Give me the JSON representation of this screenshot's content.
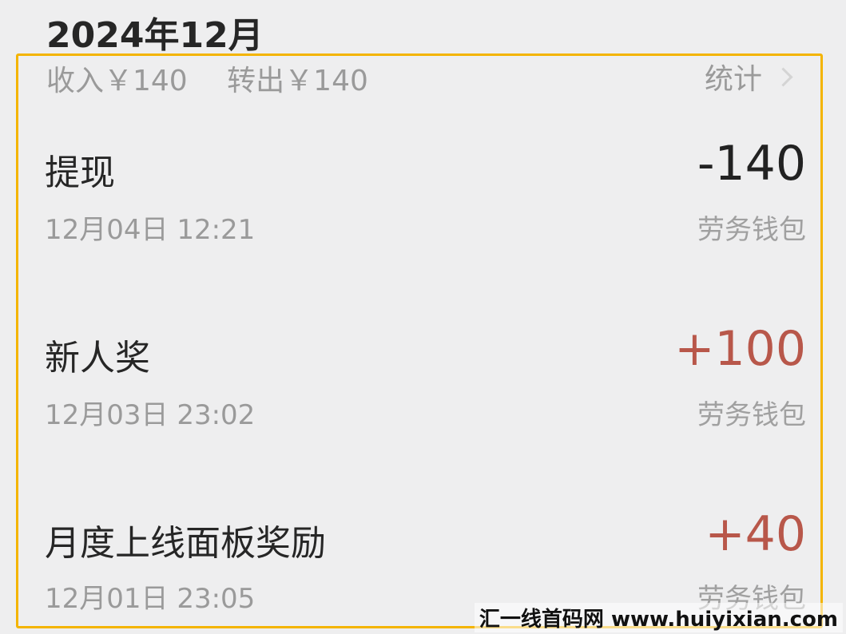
{
  "header": {
    "month": "2024年12月"
  },
  "summary": {
    "income": "收入￥140",
    "transfer_out": "转出￥140",
    "stats_label": "统计"
  },
  "colors": {
    "negative_amount": "#222222",
    "positive_amount": "#b8574a",
    "highlight_border": "#f4b400"
  },
  "transactions": [
    {
      "title": "提现",
      "amount": "-140",
      "time": "12月04日 12:21",
      "wallet": "劳务钱包"
    },
    {
      "title": "新人奖",
      "amount": "+100",
      "time": "12月03日 23:02",
      "wallet": "劳务钱包"
    },
    {
      "title": "月度上线面板奖励",
      "amount": "+40",
      "time": "12月01日 23:05",
      "wallet": "劳务钱包"
    }
  ],
  "watermark": "汇一线首码网 www.huiyixian.com"
}
